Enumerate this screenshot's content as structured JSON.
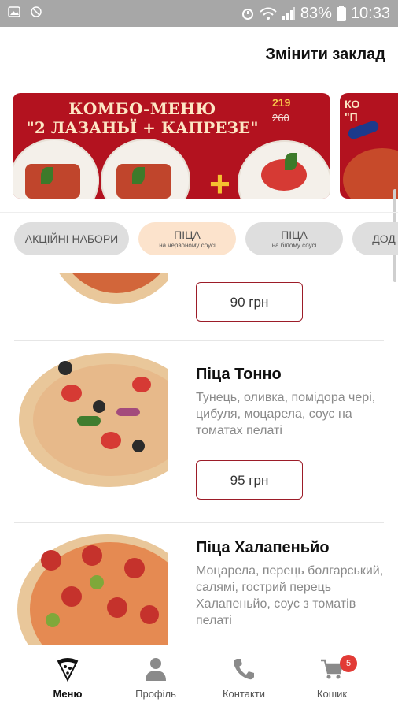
{
  "status_bar": {
    "battery": "83%",
    "time": "10:33"
  },
  "header": {
    "change_venue": "Змінити заклад"
  },
  "banners": [
    {
      "title_line1": "КОМБО-МЕНЮ",
      "title_line2": "\"2 ЛАЗАНЬЇ + КАПРЕЗЕ\"",
      "price_new": "219",
      "price_old": "260",
      "accent_color": "#b3121f"
    },
    {
      "title_line1": "КО",
      "title_line2": "\"П",
      "accent_color": "#b3121f"
    }
  ],
  "categories": [
    {
      "label": "АКЦІЙНІ НАБОРИ",
      "sub": "",
      "selected": false
    },
    {
      "label": "ПІЦА",
      "sub": "на червоному соусі",
      "selected": true
    },
    {
      "label": "ПІЦА",
      "sub": "на білому соусі",
      "selected": false
    },
    {
      "label": "ДОД",
      "sub": "",
      "selected": false
    }
  ],
  "products": [
    {
      "title": "",
      "description": "",
      "price": "90 грн"
    },
    {
      "title": "Піца Тонно",
      "description": "Тунець, оливка, помідора чері, цибуля, моцарела, соус на томатах пелаті",
      "price": "95 грн"
    },
    {
      "title": "Піца Халапеньйо",
      "description": "Моцарела, перець болгарський, салямі, гострий перець Халапеньйо, соус з томатів пелаті",
      "price": ""
    }
  ],
  "bottom_nav": [
    {
      "label": "Меню",
      "icon": "pizza-slice-icon",
      "active": true
    },
    {
      "label": "Профіль",
      "icon": "person-icon",
      "active": false
    },
    {
      "label": "Контакти",
      "icon": "phone-icon",
      "active": false
    },
    {
      "label": "Кошик",
      "icon": "cart-icon",
      "active": false,
      "badge": "5"
    }
  ],
  "colors": {
    "brand_red": "#9c1c28",
    "selected_chip": "#fce3cc",
    "chip": "#dedede",
    "badge": "#e23b36"
  }
}
